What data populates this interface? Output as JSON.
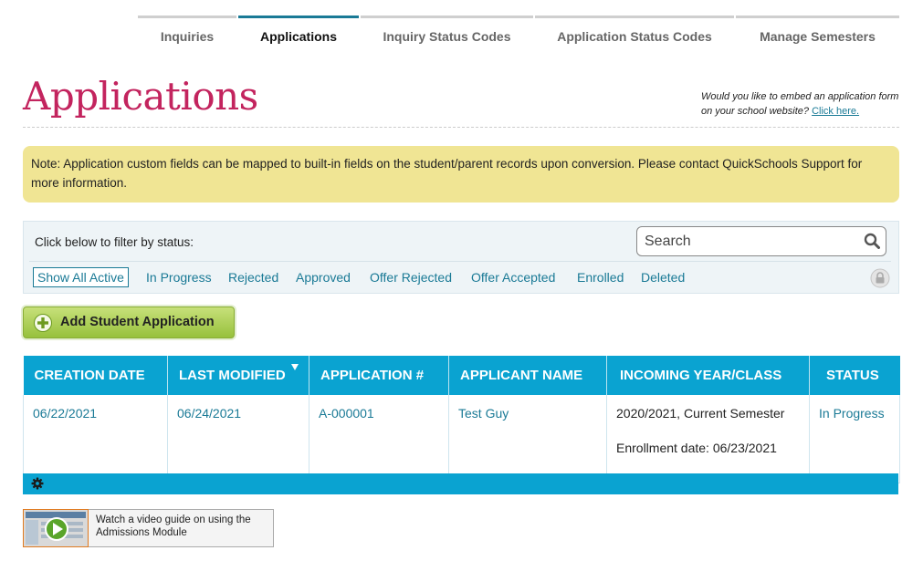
{
  "tabs": [
    {
      "label": "Inquiries",
      "active": false
    },
    {
      "label": "Applications",
      "active": true
    },
    {
      "label": "Inquiry Status Codes",
      "active": false
    },
    {
      "label": "Application Status Codes",
      "active": false
    },
    {
      "label": "Manage Semesters",
      "active": false
    }
  ],
  "page": {
    "title": "Applications",
    "embed_text": "Would you like to embed an application form on your school website?",
    "embed_link": "Click here."
  },
  "note": "Note: Application custom fields can be mapped to built-in fields on the student/parent records upon conversion. Please contact QuickSchools Support for more information.",
  "filter": {
    "label": "Click below to filter by status:",
    "search_placeholder": "Search",
    "options": [
      "Show All Active",
      "In Progress",
      "Rejected",
      "Approved",
      "Offer Rejected",
      "Offer Accepted",
      "Enrolled",
      "Deleted"
    ],
    "active_index": 0
  },
  "add_button": {
    "label": "Add Student Application"
  },
  "table": {
    "columns": [
      "CREATION DATE",
      "LAST MODIFIED",
      "APPLICATION #",
      "APPLICANT NAME",
      "INCOMING YEAR/CLASS",
      "STATUS"
    ],
    "sorted_column": "LAST MODIFIED",
    "sort_direction": "desc",
    "rows": [
      {
        "creation_date": "06/22/2021",
        "last_modified": "06/24/2021",
        "application_no": "A-000001",
        "applicant_name": "Test Guy",
        "incoming_year": "2020/2021, Current Semester",
        "enrollment_date": "Enrollment date: 06/23/2021",
        "status": "In Progress"
      }
    ]
  },
  "video_guide": {
    "text": "Watch a video guide on using the Admissions Module"
  },
  "colors": {
    "accent_teal": "#1a7a96",
    "table_header": "#0aa3d1",
    "title_crimson": "#c3245e",
    "note_yellow": "#f0e594",
    "button_green": "#97c13c"
  },
  "icons": {
    "search": "search-icon",
    "lock": "lock-icon",
    "add": "plus-circle-icon",
    "gear": "gear-icon",
    "sort": "sort-desc-icon",
    "video": "play-icon"
  }
}
